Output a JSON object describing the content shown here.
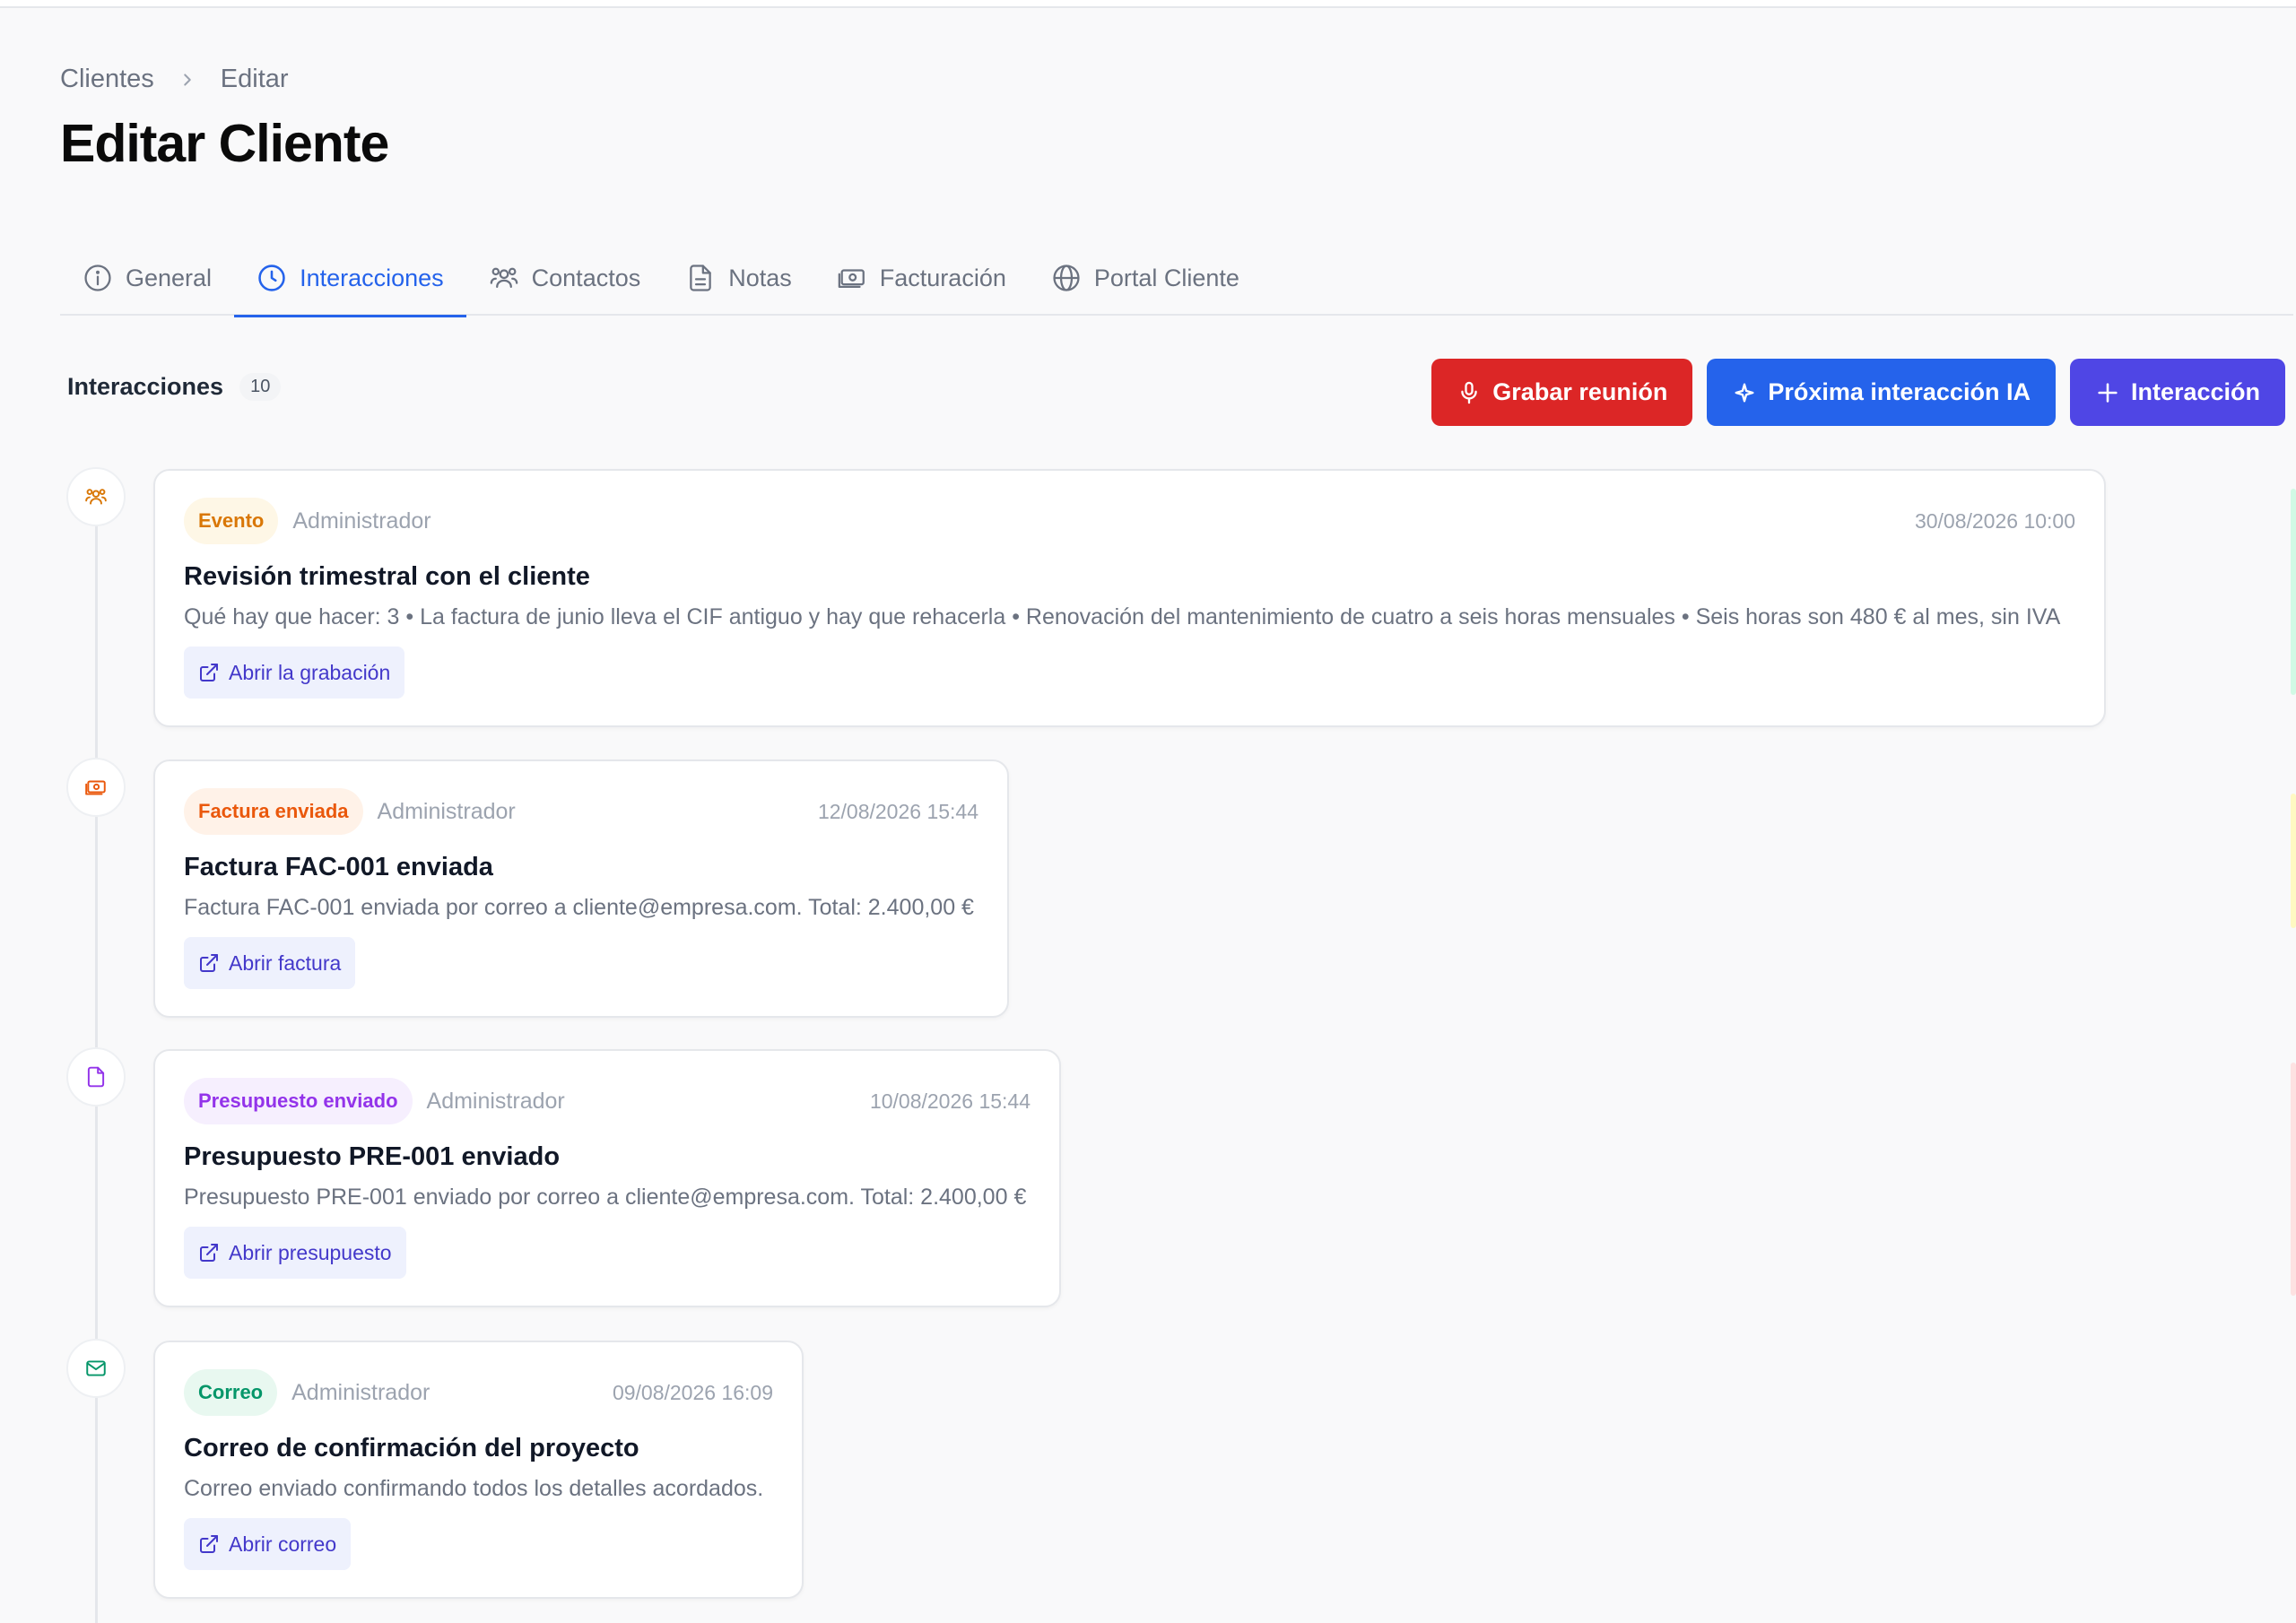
{
  "breadcrumb": {
    "root": "Clientes",
    "current": "Editar"
  },
  "page": {
    "title": "Editar Cliente"
  },
  "tabs": [
    {
      "label": "General",
      "icon": "info-icon",
      "active": false
    },
    {
      "label": "Interacciones",
      "icon": "clock-icon",
      "active": true
    },
    {
      "label": "Contactos",
      "icon": "users-icon",
      "active": false
    },
    {
      "label": "Notas",
      "icon": "file-icon",
      "active": false
    },
    {
      "label": "Facturación",
      "icon": "banknote-icon",
      "active": false
    },
    {
      "label": "Portal Cliente",
      "icon": "globe-icon",
      "active": false
    }
  ],
  "section": {
    "title": "Interacciones",
    "count": "10"
  },
  "actions": {
    "record": "Grabar reunión",
    "ai_next": "Próxima interacción IA",
    "add": "Interacción"
  },
  "colors": {
    "accent": "#2563eb",
    "record": "#dc2626",
    "add": "#4f46e5"
  },
  "interactions": [
    {
      "type": "Evento",
      "type_color": "#d97706",
      "type_bg": "#fef7e6",
      "icon": "users-icon",
      "author": "Administrador",
      "date": "30/08/2026 10:00",
      "title": "Revisión trimestral con el cliente",
      "description": "Qué hay que hacer: 3 • La factura de junio lleva el CIF antiguo y hay que rehacerla • Renovación del mantenimiento de cuatro a seis horas mensuales • Seis horas son 480 € al mes, sin IVA",
      "link": "Abrir la grabación"
    },
    {
      "type": "Factura enviada",
      "type_color": "#ea580c",
      "type_bg": "#fff2e8",
      "icon": "banknote-icon",
      "author": "Administrador",
      "date": "12/08/2026 15:44",
      "title": "Factura FAC-001 enviada",
      "description": "Factura FAC-001 enviada por correo a cliente@empresa.com. Total: 2.400,00 €",
      "link": "Abrir factura"
    },
    {
      "type": "Presupuesto enviado",
      "type_color": "#9333ea",
      "type_bg": "#f6effe",
      "icon": "file-icon",
      "author": "Administrador",
      "date": "10/08/2026 15:44",
      "title": "Presupuesto PRE-001 enviado",
      "description": "Presupuesto PRE-001 enviado por correo a cliente@empresa.com. Total: 2.400,00 €",
      "link": "Abrir presupuesto"
    },
    {
      "type": "Correo",
      "type_color": "#059669",
      "type_bg": "#e8f8f0",
      "icon": "mail-icon",
      "author": "Administrador",
      "date": "09/08/2026 16:09",
      "title": "Correo de confirmación del proyecto",
      "description": "Correo enviado confirmando todos los detalles acordados.",
      "link": "Abrir correo"
    }
  ]
}
